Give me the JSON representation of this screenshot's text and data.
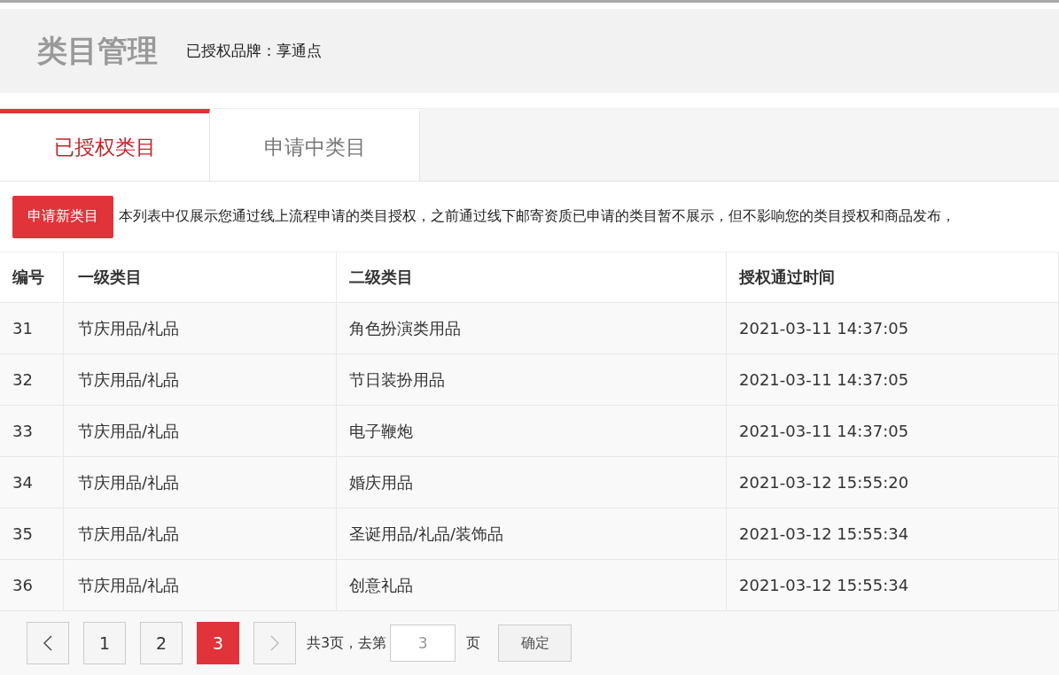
{
  "header": {
    "title": "类目管理",
    "brand_label": "已授权品牌：享通点"
  },
  "tabs": [
    {
      "label": "已授权类目",
      "selected": true
    },
    {
      "label": "申请中类目",
      "selected": false
    }
  ],
  "toolbar": {
    "button": "申请新类目",
    "notice": "本列表中仅展示您通过线上流程申请的类目授权，之前通过线下邮寄资质已申请的类目暂不展示，但不影响您的类目授权和商品发布，"
  },
  "table": {
    "columns": [
      "编号",
      "一级类目",
      "二级类目",
      "授权通过时间"
    ],
    "rows": [
      [
        "31",
        "节庆用品/礼品",
        "角色扮演类用品",
        "2021-03-11 14:37:05"
      ],
      [
        "32",
        "节庆用品/礼品",
        "节日装扮用品",
        "2021-03-11 14:37:05"
      ],
      [
        "33",
        "节庆用品/礼品",
        "电子鞭炮",
        "2021-03-11 14:37:05"
      ],
      [
        "34",
        "节庆用品/礼品",
        "婚庆用品",
        "2021-03-12 15:55:20"
      ],
      [
        "35",
        "节庆用品/礼品",
        "圣诞用品/礼品/装饰品",
        "2021-03-12 15:55:34"
      ],
      [
        "36",
        "节庆用品/礼品",
        "创意礼品",
        "2021-03-12 15:55:34"
      ]
    ]
  },
  "pagination": {
    "prev_disabled": false,
    "next_disabled": true,
    "pages": [
      {
        "label": "1",
        "selected": false
      },
      {
        "label": "2",
        "selected": false
      },
      {
        "label": "3",
        "selected": true
      }
    ],
    "summary": "共3页，去第",
    "page_input": "3",
    "page_unit": "页",
    "confirm": "确定"
  }
}
